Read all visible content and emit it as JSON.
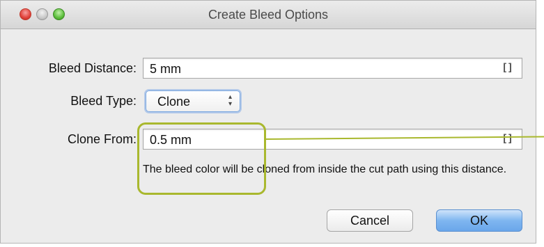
{
  "window": {
    "title": "Create Bleed Options"
  },
  "form": {
    "bleed_distance": {
      "label": "Bleed Distance:",
      "value": "5 mm",
      "unit_icon": "[]"
    },
    "bleed_type": {
      "label": "Bleed Type:",
      "selected": "Clone",
      "updown": "▲\n▼"
    },
    "clone_from": {
      "label": "Clone From:",
      "value": "0.5 mm",
      "unit_icon": "[]",
      "hint": "The bleed color will be cloned from inside the cut path using this distance."
    }
  },
  "buttons": {
    "cancel": "Cancel",
    "ok": "OK"
  },
  "colors": {
    "callout": "#a9b82e",
    "default_button": "#7fb6f0"
  },
  "icons": {
    "close": "close-window-icon",
    "minimize": "minimize-window-icon",
    "zoom": "zoom-window-icon",
    "unit": "unit-brackets-icon",
    "stepper": "up-down-arrows-icon"
  }
}
